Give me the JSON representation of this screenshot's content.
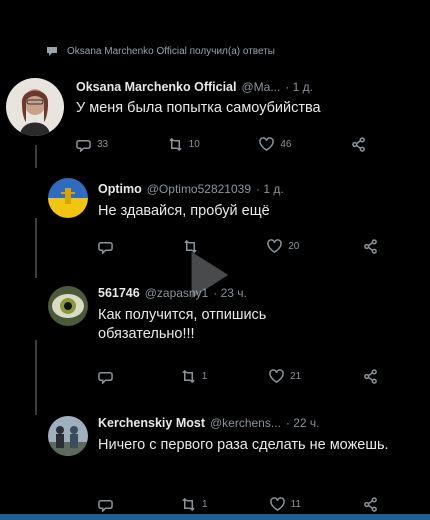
{
  "reply_indicator": {
    "text": "Oksana Marchenko Official получил(а) ответы"
  },
  "tweets": [
    {
      "name": "Oksana Marchenko Official",
      "handle": "@Ma...",
      "time": "· 1 д.",
      "text": "У меня была попытка самоубийства",
      "stats": {
        "replies": "33",
        "retweets": "10",
        "likes": "46"
      }
    },
    {
      "name": "Optimo",
      "handle": "@Optimo52821039",
      "time": "· 1 д.",
      "text": "Не здавайся, пробуй ещё",
      "stats": {
        "replies": "",
        "retweets": "",
        "likes": "20"
      }
    },
    {
      "name": "561746",
      "handle": "@zapasny1",
      "time": "· 23 ч.",
      "text": "Как получится, отпишись обязательно!!!",
      "stats": {
        "replies": "",
        "retweets": "1",
        "likes": "21"
      }
    },
    {
      "name": "Kerchenskiy Most",
      "handle": "@kerchens...",
      "time": "· 22 ч.",
      "text": "Ничего с первого раза сделать не можешь.",
      "stats": {
        "replies": "",
        "retweets": "1",
        "likes": "11"
      }
    }
  ],
  "colors": {
    "background": "#000000",
    "text": "#e7e9ea",
    "muted": "#8b949c",
    "thread_line": "#3a3f44"
  }
}
